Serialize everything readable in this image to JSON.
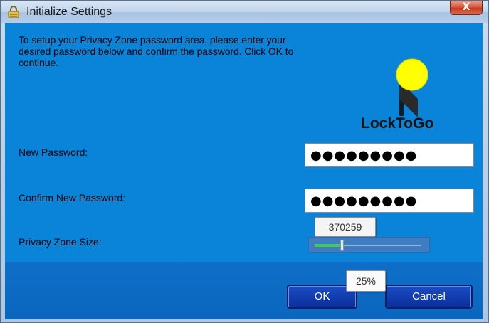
{
  "window": {
    "title": "Initialize Settings",
    "close_label": "X"
  },
  "intro": {
    "text": "To setup your Privacy Zone password area, please enter your desired password below and confirm the password. Click OK to continue."
  },
  "logo": {
    "text": "LockToGo",
    "icon": "yellow-ball-flag-icon"
  },
  "fields": {
    "new_password": {
      "label": "New Password:",
      "value": "●●●●●●●●●"
    },
    "confirm_password": {
      "label": "Confirm New Password:",
      "value": "●●●●●●●●●"
    },
    "zone_size": {
      "label": "Privacy Zone Size:",
      "tooltip": "370259",
      "percent_tooltip": "25%",
      "fraction": 0.25
    }
  },
  "buttons": {
    "ok": "OK",
    "cancel": "Cancel"
  },
  "colors": {
    "accent": "#0a84d8",
    "footer": "#0a66be",
    "slider_fill": "#3fd03f"
  }
}
